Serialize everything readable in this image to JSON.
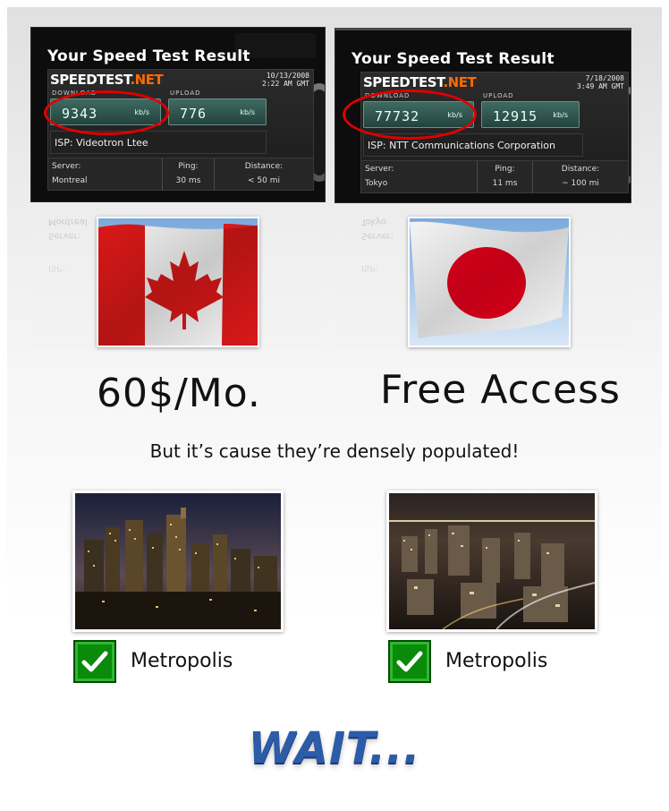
{
  "speedtests": [
    {
      "title": "Your Speed Test Result",
      "logo_main": "SPEEDTEST",
      "logo_net": ".NET",
      "date": "10/13/2008",
      "time": "2:22 AM GMT",
      "download_label": "DOWNLOAD",
      "upload_label": "UPLOAD",
      "download_value": "9343",
      "upload_value": "776",
      "unit": "kb/s",
      "isp_label": "ISP:",
      "isp_value": "Videotron Ltee",
      "server_label": "Server:",
      "server_value": "Montreal",
      "ping_label": "Ping:",
      "ping_value": "30 ms",
      "distance_label": "Distance:",
      "distance_value": "< 50 mi"
    },
    {
      "title": "Your Speed Test Result",
      "logo_main": "SPEEDTEST",
      "logo_net": ".NET",
      "date": "7/18/2008",
      "time": "3:49 AM GMT",
      "download_label": "DOWNLOAD",
      "upload_label": "UPLOAD",
      "download_value": "77732",
      "upload_value": "12915",
      "unit": "kb/s",
      "isp_label": "ISP:",
      "isp_value": "NTT Communications Corporation",
      "server_label": "Server:",
      "server_value": "Tokyo",
      "ping_label": "Ping:",
      "ping_value": "11 ms",
      "distance_label": "Distance:",
      "distance_value": "~ 100 mi"
    }
  ],
  "prices": {
    "left": "60$/Mo.",
    "right": "Free Access"
  },
  "caption": "But it’s cause they’re densely populated!",
  "metropolis": {
    "left": "Metropolis",
    "right": "Metropolis"
  },
  "closing": "WAIT...",
  "colors": {
    "accent_red": "#e00000",
    "check_green": "#0a8a0a",
    "wait_blue": "#2c5ca8",
    "speedtest_orange": "#ff6a00"
  },
  "icons": [
    "canada-flag",
    "japan-flag",
    "montreal-city-photo",
    "tokyo-city-photo",
    "checkmark-icon"
  ]
}
